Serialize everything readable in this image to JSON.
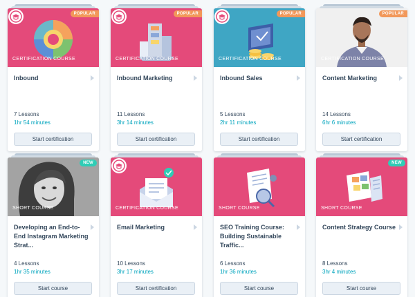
{
  "colors": {
    "pink": "#e44a7a",
    "teal": "#3fa6c4",
    "popular_badge": "#f2985a",
    "new_badge": "#2fcdb6",
    "duration_text": "#00a4bd",
    "title_text": "#33475b"
  },
  "courses": [
    {
      "type": "CERTIFICATION COURSE",
      "badge": "POPULAR",
      "title": "Inbound",
      "lessons": "7 Lessons",
      "duration": "1hr 54 minutes",
      "button": "Start certification",
      "icon": "flywheel-icon"
    },
    {
      "type": "CERTIFICATION COURSE",
      "badge": "POPULAR",
      "title": "Inbound Marketing",
      "lessons": "11 Lessons",
      "duration": "3hr 14 minutes",
      "button": "Start certification",
      "icon": "marketing-blocks-icon"
    },
    {
      "type": "CERTIFICATION COURSE",
      "badge": "POPULAR",
      "title": "Inbound Sales",
      "lessons": "5 Lessons",
      "duration": "2hr 11 minutes",
      "button": "Start certification",
      "icon": "sales-coins-icon"
    },
    {
      "type": "CERTIFICATION COURSE",
      "badge": "POPULAR",
      "title": "Content Marketing",
      "lessons": "14 Lessons",
      "duration": "6hr 6 minutes",
      "button": "Start certification",
      "icon": "instructor-photo"
    },
    {
      "type": "SHORT COURSE",
      "badge": "NEW",
      "title": "Developing an End-to-End Instagram Marketing Strat...",
      "lessons": "4 Lessons",
      "duration": "1hr 35 minutes",
      "button": "Start course",
      "icon": "instructor-photo"
    },
    {
      "type": "CERTIFICATION COURSE",
      "badge": "",
      "title": "Email Marketing",
      "lessons": "10 Lessons",
      "duration": "3hr 17 minutes",
      "button": "Start certification",
      "icon": "email-envelope-icon"
    },
    {
      "type": "SHORT COURSE",
      "badge": "",
      "title": "SEO Training Course: Building Sustainable Traffic...",
      "lessons": "6 Lessons",
      "duration": "1hr 36 minutes",
      "button": "Start course",
      "icon": "seo-magnifier-icon"
    },
    {
      "type": "SHORT COURSE",
      "badge": "NEW",
      "title": "Content Strategy Course",
      "lessons": "8 Lessons",
      "duration": "3hr 4 minutes",
      "button": "Start course",
      "icon": "content-board-icon"
    }
  ]
}
